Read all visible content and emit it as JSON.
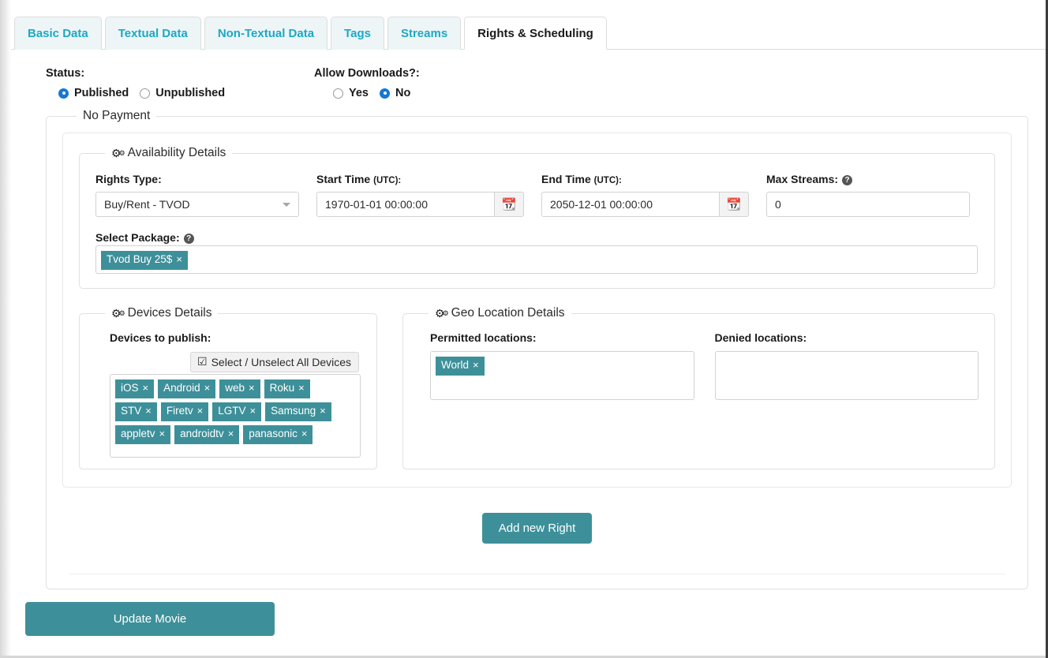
{
  "tabs": [
    {
      "label": "Basic Data",
      "active": false
    },
    {
      "label": "Textual Data",
      "active": false
    },
    {
      "label": "Non-Textual Data",
      "active": false
    },
    {
      "label": "Tags",
      "active": false
    },
    {
      "label": "Streams",
      "active": false
    },
    {
      "label": "Rights & Scheduling",
      "active": true
    }
  ],
  "status": {
    "label": "Status:",
    "options": [
      {
        "label": "Published",
        "checked": true
      },
      {
        "label": "Unpublished",
        "checked": false
      }
    ]
  },
  "downloads": {
    "label": "Allow Downloads?:",
    "options": [
      {
        "label": "Yes",
        "checked": false
      },
      {
        "label": "No",
        "checked": true
      }
    ]
  },
  "payment_fieldset": {
    "legend": "No Payment"
  },
  "availability": {
    "legend": "Availability Details",
    "gear_icon": "gears-icon",
    "rights_type": {
      "label": "Rights Type:",
      "value": "Buy/Rent - TVOD",
      "caret_icon": "chevron-down-icon"
    },
    "start_time": {
      "label": "Start Time",
      "label_sub": "(UTC):",
      "value": "1970-01-01 00:00:00",
      "calendar_icon": "calendar-icon"
    },
    "end_time": {
      "label": "End Time",
      "label_sub": "(UTC):",
      "value": "2050-12-01 00:00:00",
      "calendar_icon": "calendar-icon"
    },
    "max_streams": {
      "label": "Max Streams:",
      "value": "0",
      "help_icon": "question-mark-icon",
      "help_glyph": "?"
    },
    "select_package": {
      "label": "Select Package:",
      "help_icon": "question-mark-icon",
      "help_glyph": "?",
      "tags": [
        "Tvod Buy 25$"
      ]
    }
  },
  "devices": {
    "legend": "Devices Details",
    "gear_icon": "gears-icon",
    "label": "Devices to publish:",
    "select_all": {
      "label": "Select / Unselect All Devices",
      "check_icon": "checked-checkbox-icon",
      "check_glyph": "☑"
    },
    "tags": [
      "iOS",
      "Android",
      "web",
      "Roku",
      "STV",
      "Firetv",
      "LGTV",
      "Samsung",
      "appletv",
      "androidtv",
      "panasonic"
    ]
  },
  "geo": {
    "legend": "Geo Location Details",
    "gear_icon": "gears-icon",
    "permitted": {
      "label": "Permitted locations:",
      "tags": [
        "World"
      ]
    },
    "denied": {
      "label": "Denied locations:",
      "tags": []
    }
  },
  "buttons": {
    "add_new_right": "Add new Right",
    "update_movie": "Update Movie"
  },
  "colors": {
    "teal_accent": "#3d9099",
    "tab_link": "#1ba9c4",
    "radio_blue": "#1577d5",
    "tab_inactive_bg": "#eef5f7"
  },
  "tag_remove_glyph": "×"
}
